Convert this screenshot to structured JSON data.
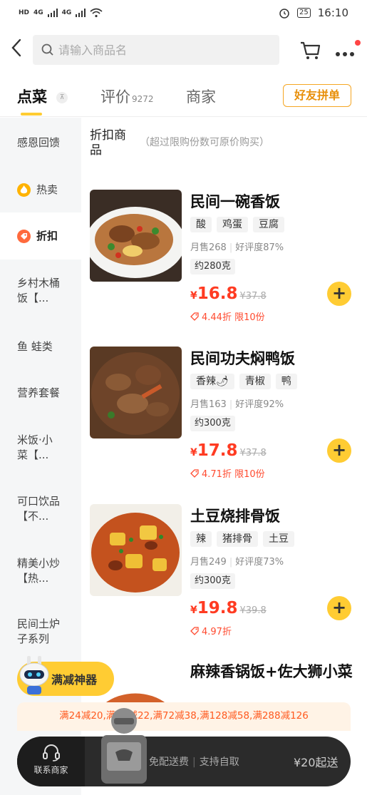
{
  "status_bar": {
    "time": "16:10",
    "battery": "25",
    "network_labels": [
      "HD",
      "4G",
      "4G"
    ]
  },
  "search": {
    "placeholder": "请输入商品名"
  },
  "tabs": [
    {
      "label": "点菜",
      "active": true
    },
    {
      "label": "评价",
      "count": "9272"
    },
    {
      "label": "商家"
    }
  ],
  "group_button": "好友拼单",
  "sidebar": {
    "items": [
      {
        "label": "感恩回馈"
      },
      {
        "label": "热卖",
        "icon": "fire-icon"
      },
      {
        "label": "折扣",
        "icon": "discount-icon",
        "active": true
      },
      {
        "label": "乡村木桶饭【...",
        "line1": "乡村木桶",
        "line2": "饭【..."
      },
      {
        "label": "鱼 蛙类"
      },
      {
        "label": "营养套餐"
      },
      {
        "label": "米饭·小菜【...",
        "line1": "米饭·小",
        "line2": "菜【..."
      },
      {
        "label": "可口饮品【不...",
        "line1": "可口饮品",
        "line2": "【不..."
      },
      {
        "label": "精美小炒【热...",
        "line1": "精美小炒",
        "line2": "【热..."
      },
      {
        "label": "民间土炉子系列",
        "line1": "民间土炉",
        "line2": "子系列"
      }
    ]
  },
  "section": {
    "title": "折扣商品",
    "note": "（超过限购份数可原价购买）"
  },
  "items": [
    {
      "name": "民间一碗香饭",
      "tags": [
        "酸",
        "鸡蛋",
        "豆腐"
      ],
      "monthly_sales": "月售268",
      "rating": "好评度87%",
      "weight": "约280克",
      "price_symbol": "¥",
      "price": "16.8",
      "original_price": "¥37.8",
      "discount": "4.44折 限10份"
    },
    {
      "name": "民间功夫焖鸭饭",
      "tags": [
        "香辣🌶",
        "青椒",
        "鸭"
      ],
      "monthly_sales": "月售163",
      "rating": "好评度92%",
      "weight": "约300克",
      "price_symbol": "¥",
      "price": "17.8",
      "original_price": "¥37.8",
      "discount": "4.71折 限10份"
    },
    {
      "name": "土豆烧排骨饭",
      "tags": [
        "辣",
        "猪排骨",
        "土豆"
      ],
      "monthly_sales": "月售249",
      "rating": "好评度73%",
      "weight": "约300克",
      "price_symbol": "¥",
      "price": "19.8",
      "original_price": "¥39.8",
      "discount": "4.97折"
    },
    {
      "name": "麻辣香锅饭+佐大狮小菜"
    }
  ],
  "promo_pill": "满减神器",
  "promo_bar": "满24减20,满51减22,满72减38,满128减58,满288减126",
  "bottom_bar": {
    "contact": "联系商家",
    "free_delivery": "免配送费",
    "self_pickup": "支持自取",
    "minimum": "¥20起送"
  },
  "colors": {
    "accent": "#ffcc33",
    "price_red": "#ff3b22",
    "sidebar_bg": "#f5f6f7",
    "group_button": "#e8900c"
  }
}
